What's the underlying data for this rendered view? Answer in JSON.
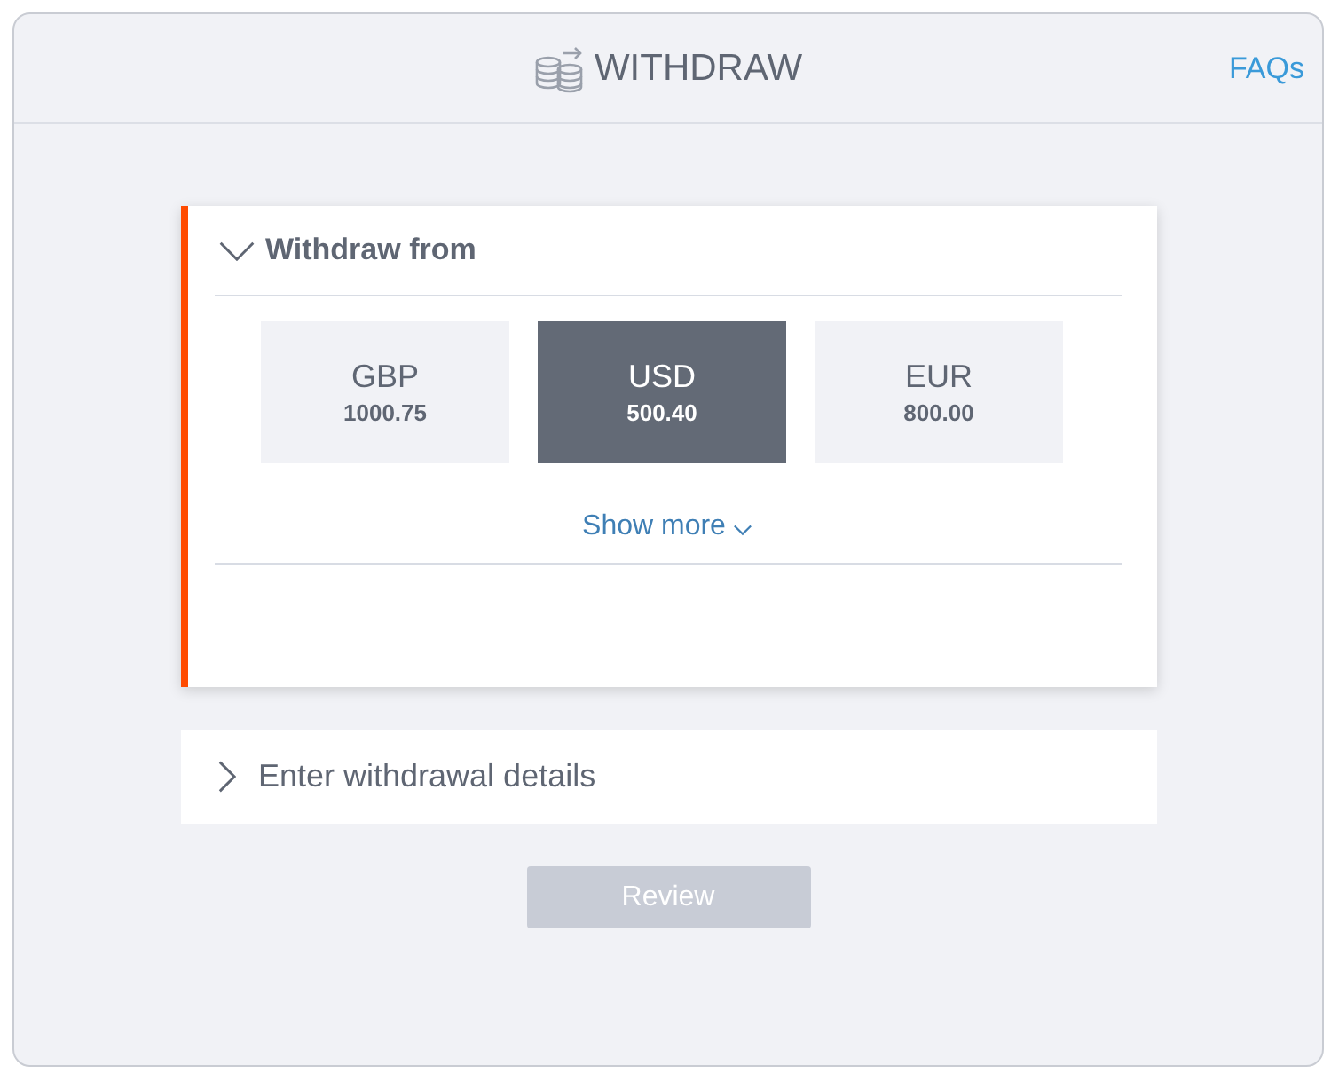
{
  "header": {
    "title": "WITHDRAW",
    "faqs_link": "FAQs"
  },
  "sections": [
    {
      "title": "Withdraw from",
      "expanded": true,
      "accounts": [
        {
          "currency": "GBP",
          "balance": "1000.75",
          "selected": false
        },
        {
          "currency": "USD",
          "balance": "500.40",
          "selected": true
        },
        {
          "currency": "EUR",
          "balance": "800.00",
          "selected": false
        }
      ],
      "show_more": "Show more"
    },
    {
      "title": "Enter withdrawal details",
      "expanded": false
    }
  ],
  "review_button": {
    "label": "Review",
    "disabled": true
  }
}
